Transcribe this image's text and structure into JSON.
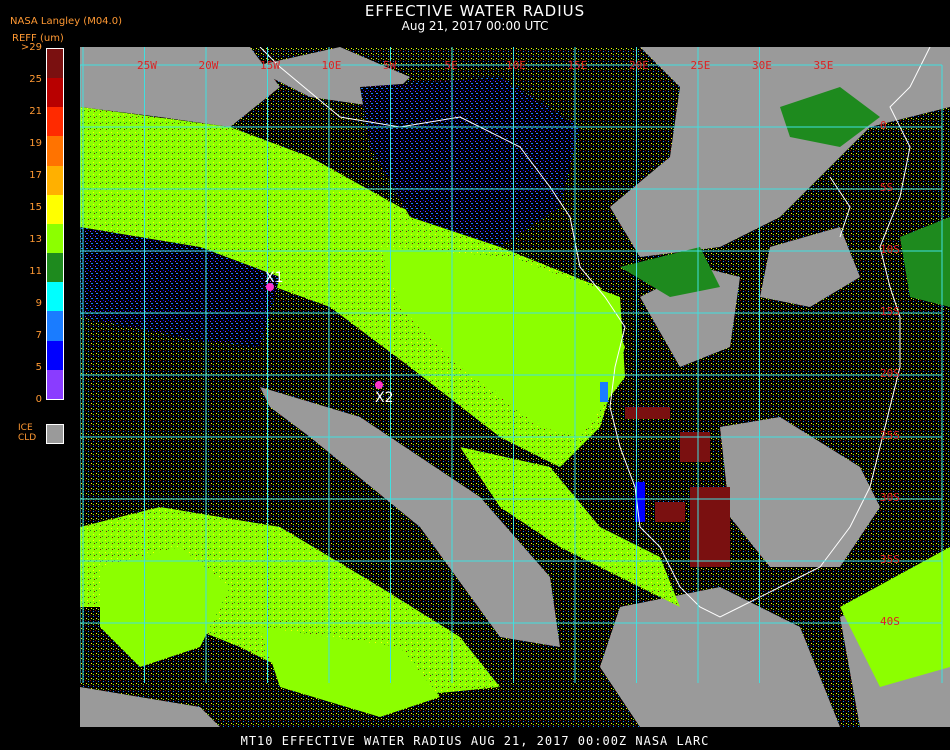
{
  "header": {
    "title": "EFFECTIVE WATER RADIUS",
    "subtitle": "Aug 21, 2017 00:00 UTC",
    "org": "NASA Langley (M04.0)"
  },
  "legend": {
    "unit": "REFF (um)",
    "ticks": [
      ">29",
      "25",
      "21",
      "19",
      "17",
      "15",
      "13",
      "11",
      "9",
      "7",
      "5",
      "0"
    ],
    "colors": [
      "#7a1010",
      "#b80000",
      "#ff2a00",
      "#ff7300",
      "#ffb000",
      "#ffff00",
      "#8cff00",
      "#1e8a1e",
      "#00ffff",
      "#1a7cff",
      "#0000ff",
      "#8a3cff"
    ],
    "ice_label_1": "ICE",
    "ice_label_2": "CLD",
    "ice_color": "#9a9a9a"
  },
  "map": {
    "lon_labels": [
      "25W",
      "20W",
      "15W",
      "10E",
      "5W",
      "5E",
      "10E",
      "15E",
      "20E",
      "25E",
      "30E",
      "35E"
    ],
    "lat_labels": [
      "0",
      "5S",
      "10S",
      "15S",
      "20S",
      "25S",
      "30S",
      "35S",
      "40S"
    ],
    "markers": [
      {
        "label": "X1"
      },
      {
        "label": "X2"
      }
    ]
  },
  "footer": {
    "text": "MT10  EFFECTIVE WATER RADIUS   AUG 21, 2017 00:00Z   NASA LARC"
  }
}
